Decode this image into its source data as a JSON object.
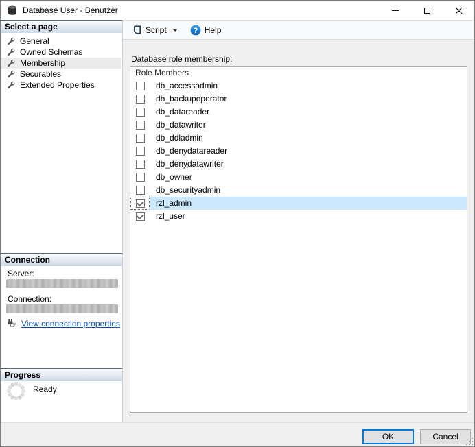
{
  "window": {
    "title": "Database User - Benutzer",
    "controls": {
      "minimize": "minimize",
      "maximize": "maximize",
      "close": "close"
    }
  },
  "toolbar": {
    "script_label": "Script",
    "help_label": "Help"
  },
  "sidebar": {
    "select_page_header": "Select a page",
    "pages": [
      {
        "label": "General",
        "selected": false
      },
      {
        "label": "Owned Schemas",
        "selected": false
      },
      {
        "label": "Membership",
        "selected": true
      },
      {
        "label": "Securables",
        "selected": false
      },
      {
        "label": "Extended Properties",
        "selected": false
      }
    ],
    "connection_header": "Connection",
    "server_label": "Server:",
    "connection_label": "Connection:",
    "view_connection_link": "View connection properties",
    "progress_header": "Progress",
    "progress_status": "Ready"
  },
  "main": {
    "membership_label": "Database role membership:",
    "list": {
      "header": "Role Members",
      "rows": [
        {
          "label": "db_accessadmin",
          "checked": false,
          "selected": false
        },
        {
          "label": "db_backupoperator",
          "checked": false,
          "selected": false
        },
        {
          "label": "db_datareader",
          "checked": false,
          "selected": false
        },
        {
          "label": "db_datawriter",
          "checked": false,
          "selected": false
        },
        {
          "label": "db_ddladmin",
          "checked": false,
          "selected": false
        },
        {
          "label": "db_denydatareader",
          "checked": false,
          "selected": false
        },
        {
          "label": "db_denydatawriter",
          "checked": false,
          "selected": false
        },
        {
          "label": "db_owner",
          "checked": false,
          "selected": false
        },
        {
          "label": "db_securityadmin",
          "checked": false,
          "selected": false
        },
        {
          "label": "rzl_admin",
          "checked": true,
          "selected": true
        },
        {
          "label": "rzl_user",
          "checked": true,
          "selected": false
        }
      ]
    }
  },
  "footer": {
    "ok_label": "OK",
    "cancel_label": "Cancel"
  },
  "colors": {
    "selection_blue": "#cce8ff",
    "default_button_border": "#0078d7",
    "link_blue": "#0645ad",
    "header_gradient_bottom": "#ccd9e8"
  }
}
